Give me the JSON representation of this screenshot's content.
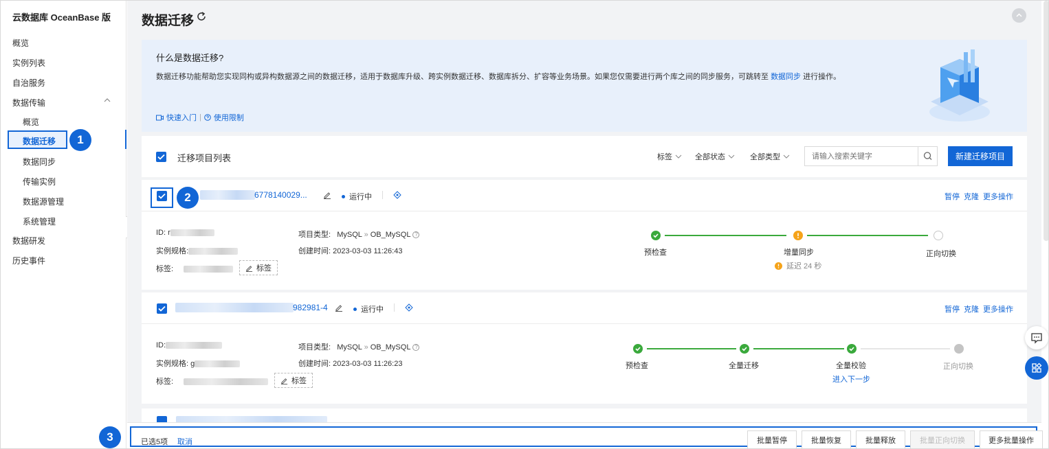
{
  "sidebar": {
    "title": "云数据库 OceanBase 版",
    "items": [
      {
        "label": "概览"
      },
      {
        "label": "实例列表"
      },
      {
        "label": "自治服务"
      },
      {
        "label": "数据传输"
      },
      {
        "label": "概览"
      },
      {
        "label": "数据迁移"
      },
      {
        "label": "数据同步"
      },
      {
        "label": "传输实例"
      },
      {
        "label": "数据源管理"
      },
      {
        "label": "系统管理"
      },
      {
        "label": "数据研发"
      },
      {
        "label": "历史事件"
      }
    ]
  },
  "callouts": [
    "1",
    "2",
    "3"
  ],
  "header": {
    "title": "数据迁移"
  },
  "intro": {
    "title": "什么是数据迁移?",
    "desc_before": "数据迁移功能帮助您实现同构或异构数据源之间的数据迁移，适用于数据库升级、跨实例数据迁移、数据库拆分、扩容等业务场景。如果您仅需要进行两个库之间的同步服务，可跳转至 ",
    "desc_link": "数据同步",
    "desc_after": " 进行操作。",
    "quick_start": "快速入门",
    "divider": "|",
    "limits": "使用限制"
  },
  "list": {
    "title": "迁移项目列表",
    "filters": {
      "tag": "标签",
      "status": "全部状态",
      "type": "全部类型"
    },
    "search_placeholder": "请输入搜索关键字",
    "new_button": "新建迁移项目"
  },
  "projects": [
    {
      "name_tail": "6778140029...",
      "status": "运行中",
      "actions": [
        "暂停",
        "克隆",
        "更多操作"
      ],
      "id_label": "ID:",
      "id_prefix": "r",
      "spec_label": "实例规格:",
      "tag_label": "标签:",
      "tag_button": "标签",
      "type_label": "项目类型:",
      "source": "MySQL",
      "arrow": "»",
      "target": "OB_MySQL",
      "created_label": "创建时间:",
      "created": "2023-03-03 11:26:43",
      "steps": [
        {
          "label": "预检查",
          "state": "done"
        },
        {
          "label": "增量同步",
          "state": "warning"
        },
        {
          "label": "正向切换",
          "state": "pending"
        }
      ],
      "delay": "延迟 24 秒"
    },
    {
      "name_tail": "982981-4",
      "status": "运行中",
      "actions": [
        "暂停",
        "克隆",
        "更多操作"
      ],
      "id_label": "ID:",
      "spec_label": "实例规格:",
      "spec_prefix": "g",
      "tag_label": "标签:",
      "tag_button": "标签",
      "type_label": "项目类型:",
      "source": "MySQL",
      "arrow": "»",
      "target": "OB_MySQL",
      "created_label": "创建时间:",
      "created": "2023-03-03 11:26:23",
      "steps": [
        {
          "label": "预检查",
          "state": "done"
        },
        {
          "label": "全量迁移",
          "state": "done"
        },
        {
          "label": "全量校验",
          "state": "done"
        },
        {
          "label": "正向切换",
          "state": "disabled"
        }
      ],
      "next_step": "进入下一步"
    }
  ],
  "bottom": {
    "selected": "已选5项",
    "cancel": "取消",
    "buttons": [
      "批量暂停",
      "批量恢复",
      "批量释放",
      "批量正向切换",
      "更多批量操作"
    ]
  },
  "colors": {
    "primary": "#1266d6",
    "success": "#3aa93c",
    "warning": "#f5a31a"
  }
}
